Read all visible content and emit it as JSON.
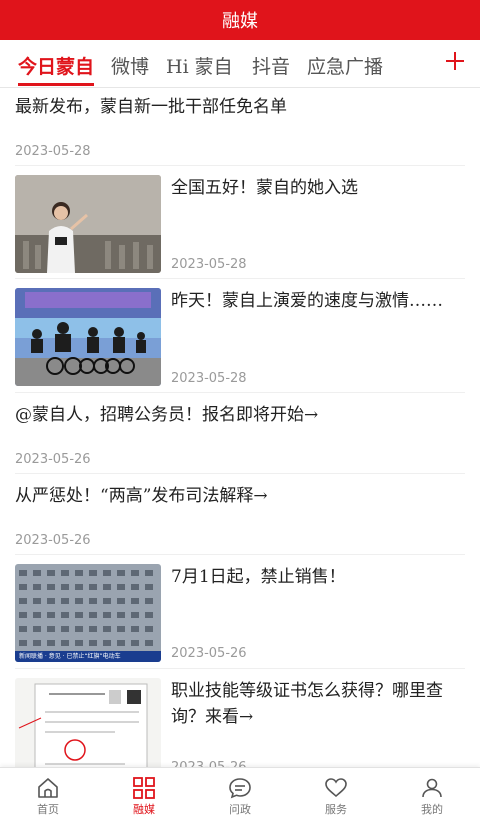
{
  "header": {
    "title": "融媒"
  },
  "tabs": [
    {
      "label": "今日蒙自"
    },
    {
      "label": "微博"
    },
    {
      "label": "Hi 蒙自"
    },
    {
      "label": "抖音"
    },
    {
      "label": "应急广播"
    }
  ],
  "add_channel_icon": "plus-icon",
  "feed": [
    {
      "title": "最新发布，蒙自新一批干部任免名单",
      "date": "2023-05-28"
    },
    {
      "title": "全国五好！蒙自的她入选",
      "date": "2023-05-28",
      "image": "woman-in-exhibition-photo"
    },
    {
      "title": "昨天！蒙自上演爱的速度与激情……",
      "date": "2023-05-28",
      "image": "cycling-race-photo"
    },
    {
      "title": "@蒙自人，招聘公务员！报名即将开始→",
      "date": "2023-05-26"
    },
    {
      "title": "从严惩处！“两高”发布司法解释→",
      "date": "2023-05-26"
    },
    {
      "title": "7月1日起，禁止销售！",
      "date": "2023-05-26",
      "image": "electric-bikes-lot-photo",
      "image_caption": "新闻联播 · 意见 · 已禁止“红旗”电动车"
    },
    {
      "title": "职业技能等级证书怎么获得？哪里查询？来看→",
      "date": "2023-05-26",
      "image": "certificate-document-photo"
    }
  ],
  "bottom_nav": [
    {
      "label": "首页",
      "icon": "home-icon"
    },
    {
      "label": "融媒",
      "icon": "grid-icon",
      "active": true
    },
    {
      "label": "问政",
      "icon": "chat-bubble-icon"
    },
    {
      "label": "服务",
      "icon": "heart-icon"
    },
    {
      "label": "我的",
      "icon": "user-icon"
    }
  ],
  "colors": {
    "brand": "#e0141b",
    "muted": "#9a9a9a"
  }
}
